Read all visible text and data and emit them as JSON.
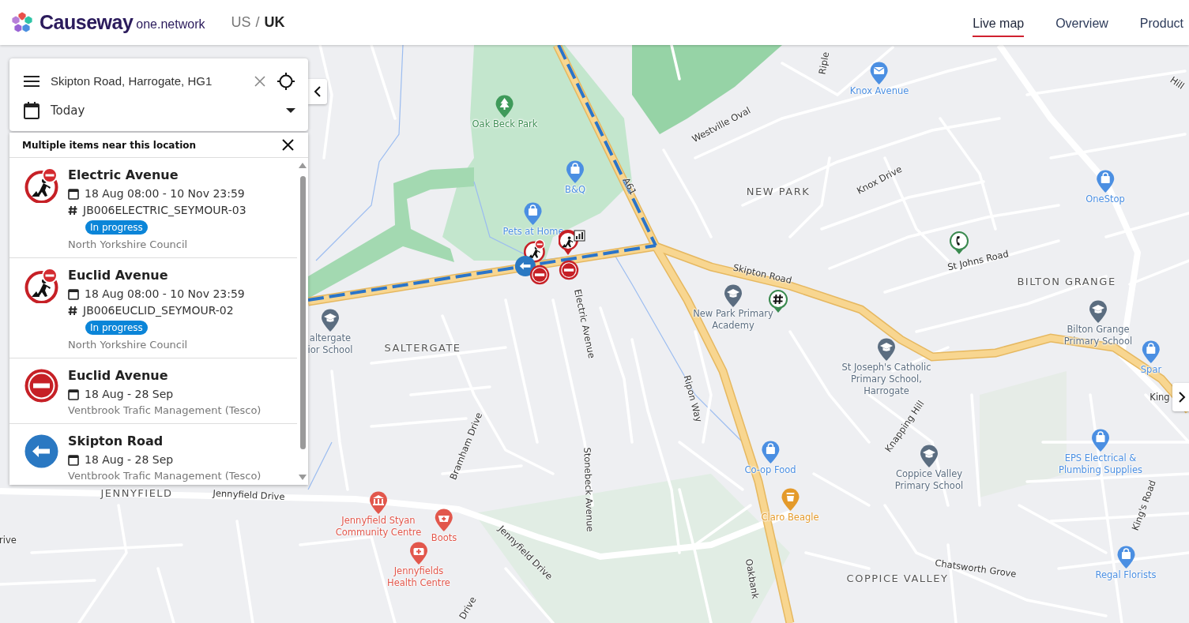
{
  "header": {
    "brand": "Causeway",
    "product": "one.network",
    "regions": [
      {
        "label": "US",
        "selected": false
      },
      {
        "label": "UK",
        "selected": true
      }
    ],
    "region_separator": "/",
    "nav": [
      {
        "label": "Live map",
        "selected": true
      },
      {
        "label": "Overview",
        "selected": false
      },
      {
        "label": "Product",
        "selected": false
      }
    ]
  },
  "search": {
    "value": "Skipton Road, Harrogate, HG1",
    "date": "Today"
  },
  "results": {
    "title": "Multiple items near this location",
    "items": [
      {
        "kind": "roadworks",
        "title": "Electric Avenue",
        "dates": "18 Aug 08:00 - 10 Nov 23:59",
        "reference": "JB006ELECTRIC_SEYMOUR-03",
        "status": "In progress",
        "organisation": "North Yorkshire Council"
      },
      {
        "kind": "roadworks",
        "title": "Euclid Avenue",
        "dates": "18 Aug 08:00 - 10 Nov 23:59",
        "reference": "JB006EUCLID_SEYMOUR-02",
        "status": "In progress",
        "organisation": "North Yorkshire Council"
      },
      {
        "kind": "closure",
        "title": "Euclid Avenue",
        "dates": "18 Aug - 28 Sep",
        "organisation": "Ventbrook Trafic Management (Tesco)"
      },
      {
        "kind": "diversion",
        "title": "Skipton Road",
        "dates": "18 Aug - 28 Sep",
        "organisation": "Ventbrook Trafic Management (Tesco)"
      }
    ]
  },
  "map": {
    "labels": [
      {
        "text": "Riple",
        "kind": "road"
      },
      {
        "text": "Knox Avenue",
        "kind": "post"
      },
      {
        "text": "Oak Beck Park",
        "kind": "park"
      },
      {
        "text": "Westville Oval",
        "kind": "road"
      },
      {
        "text": "A61",
        "kind": "road"
      },
      {
        "text": "B&Q",
        "kind": "shop"
      },
      {
        "text": "Knox Drive",
        "kind": "road"
      },
      {
        "text": "NEW PARK",
        "kind": "area"
      },
      {
        "text": "OneStop",
        "kind": "shop"
      },
      {
        "text": "Hill",
        "kind": "road"
      },
      {
        "text": "Pets at Home",
        "kind": "shop"
      },
      {
        "text": "St Johns Road",
        "kind": "road"
      },
      {
        "text": "Skipton Road",
        "kind": "road"
      },
      {
        "text": "BILTON GRANGE",
        "kind": "area"
      },
      {
        "text": "New Park Primary Academy",
        "kind": "school"
      },
      {
        "text": "altergate ior School",
        "kind": "school"
      },
      {
        "text": "SALTERGATE",
        "kind": "area"
      },
      {
        "text": "Electric Avenue",
        "kind": "road"
      },
      {
        "text": "St Joseph's Catholic Primary School, Harrogate",
        "kind": "school"
      },
      {
        "text": "Bilton Grange Primary School",
        "kind": "school"
      },
      {
        "text": "Spar",
        "kind": "shop"
      },
      {
        "text": "King",
        "kind": "road"
      },
      {
        "text": "Ripon Way",
        "kind": "road"
      },
      {
        "text": "Knapping Hill",
        "kind": "road"
      },
      {
        "text": "Bramham Drive",
        "kind": "road"
      },
      {
        "text": "Co-op Food",
        "kind": "shop"
      },
      {
        "text": "Coppice Valley Primary School",
        "kind": "school"
      },
      {
        "text": "EPS Electrical & Plumbing Supplies",
        "kind": "shop"
      },
      {
        "text": "Stonebeck Avenue",
        "kind": "road"
      },
      {
        "text": "JENNYFIELD",
        "kind": "area"
      },
      {
        "text": "Jennyfield Drive",
        "kind": "road"
      },
      {
        "text": "King's Road",
        "kind": "road"
      },
      {
        "text": "rive",
        "kind": "road"
      },
      {
        "text": "Jennyfield Styan Community Centre",
        "kind": "civic"
      },
      {
        "text": "Boots",
        "kind": "pharmacy"
      },
      {
        "text": "Claro Beagle",
        "kind": "food"
      },
      {
        "text": "Jennyfields Health Centre",
        "kind": "health"
      },
      {
        "text": "Jennyfield Drive",
        "kind": "road"
      },
      {
        "text": "Oakbank",
        "kind": "road"
      },
      {
        "text": "COPPICE VALLEY",
        "kind": "area"
      },
      {
        "text": "Chatsworth Grove",
        "kind": "road"
      },
      {
        "text": "Regal Florists",
        "kind": "shop"
      },
      {
        "text": "Drive",
        "kind": "road"
      }
    ],
    "markers": [
      {
        "kind": "roadworks"
      },
      {
        "kind": "roadworks-chart"
      },
      {
        "kind": "diversion"
      },
      {
        "kind": "closure"
      },
      {
        "kind": "closure"
      },
      {
        "kind": "phone"
      },
      {
        "kind": "hash"
      }
    ]
  }
}
